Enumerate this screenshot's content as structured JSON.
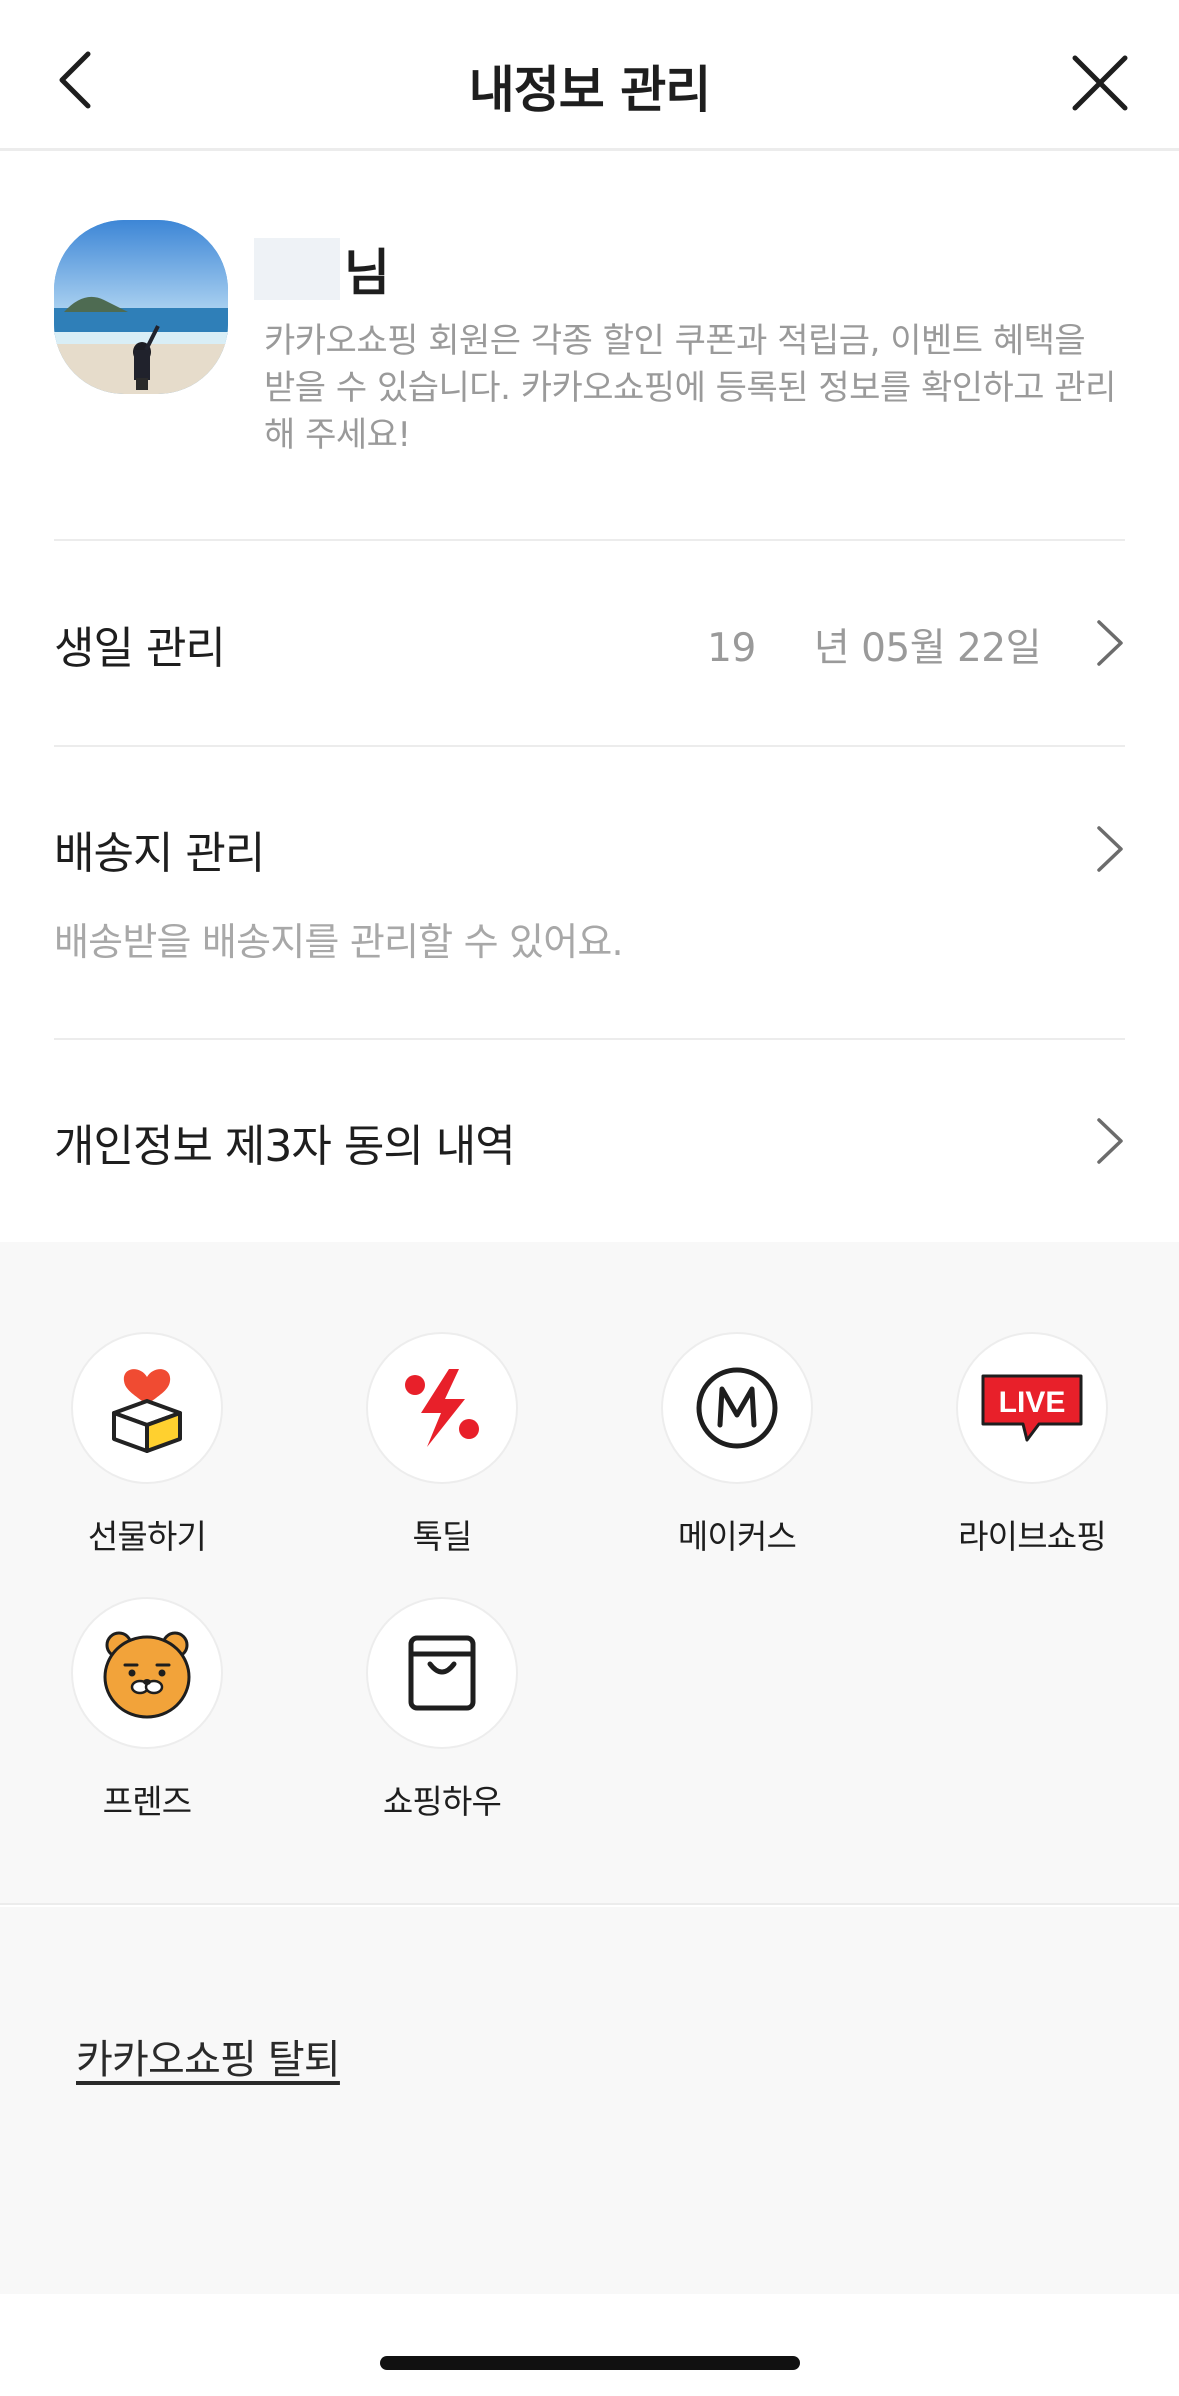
{
  "header": {
    "title": "내정보 관리",
    "back_icon": "chevron-left-icon",
    "close_icon": "close-icon"
  },
  "profile": {
    "name_suffix": "님",
    "description": "카카오쇼핑 회원은 각종 할인 쿠폰과 적립금, 이벤트 혜택을 받을 수 있습니다. 카카오쇼핑에 등록된 정보를 확인하고 관리해 주세요!"
  },
  "menu": {
    "birthday": {
      "label": "생일 관리",
      "year_prefix": "19",
      "date_rest": "년 05월 22일"
    },
    "shipping": {
      "label": "배송지 관리",
      "sub": "배송받을 배송지를 관리할 수 있어요."
    },
    "consent": {
      "label": "개인정보 제3자 동의 내역"
    }
  },
  "services": [
    {
      "label": "선물하기",
      "icon": "gift-box-heart-icon"
    },
    {
      "label": "톡딜",
      "icon": "talkdeal-percent-icon"
    },
    {
      "label": "메이커스",
      "icon": "makers-m-icon"
    },
    {
      "label": "라이브쇼핑",
      "icon": "live-badge-icon"
    },
    {
      "label": "프렌즈",
      "icon": "ryan-bear-icon"
    },
    {
      "label": "쇼핑하우",
      "icon": "shopping-bag-icon"
    }
  ],
  "footer": {
    "withdraw_label": "카카오쇼핑 탈퇴"
  },
  "colors": {
    "text": "#1e1e1e",
    "muted": "#9a9a9a",
    "section_bg": "#f8f8f8",
    "live_red": "#e8202a",
    "ryan_orange": "#f2a33a"
  }
}
